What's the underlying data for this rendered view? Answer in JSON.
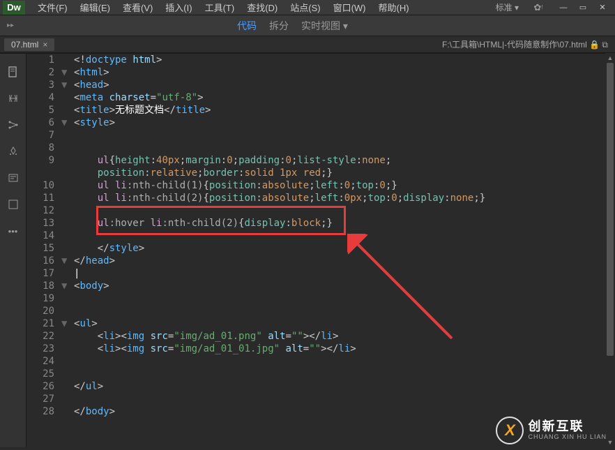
{
  "app": {
    "logo": "Dw"
  },
  "menu": {
    "file": "文件(F)",
    "edit": "编辑(E)",
    "view": "查看(V)",
    "insert": "插入(I)",
    "tools": "工具(T)",
    "find": "查找(D)",
    "site": "站点(S)",
    "window": "窗口(W)",
    "help": "帮助(H)"
  },
  "workspace": "标准 ▾",
  "viewTabs": {
    "code": "代码",
    "split": "拆分",
    "live": "实时视图 ▾"
  },
  "doc": {
    "tab": "07.html",
    "path": "F:\\工具箱\\HTML|-代码随意制作\\07.html"
  },
  "code": {
    "lines": [
      {
        "n": 1,
        "fold": "",
        "html": "<span class='t-punc'>&lt;!</span><span class='t-tag'>doctype</span> <span class='t-attr'>html</span><span class='t-punc'>&gt;</span>"
      },
      {
        "n": 2,
        "fold": "▼",
        "html": "<span class='t-punc'>&lt;</span><span class='t-tag'>html</span><span class='t-punc'>&gt;</span>"
      },
      {
        "n": 3,
        "fold": "▼",
        "html": "<span class='t-punc'>&lt;</span><span class='t-tag'>head</span><span class='t-punc'>&gt;</span>"
      },
      {
        "n": 4,
        "fold": "",
        "html": "<span class='t-punc'>&lt;</span><span class='t-tag'>meta</span> <span class='t-attr'>charset</span><span class='t-punc'>=</span><span class='t-str'>\"utf-8\"</span><span class='t-punc'>&gt;</span>"
      },
      {
        "n": 5,
        "fold": "",
        "html": "<span class='t-punc'>&lt;</span><span class='t-tag'>title</span><span class='t-punc'>&gt;</span><span class='t-txt'>无标题文档</span><span class='t-punc'>&lt;/</span><span class='t-tag'>title</span><span class='t-punc'>&gt;</span>"
      },
      {
        "n": 6,
        "fold": "▼",
        "html": "<span class='t-punc'>&lt;</span><span class='t-tag'>style</span><span class='t-punc'>&gt;</span>"
      },
      {
        "n": 7,
        "fold": "",
        "html": ""
      },
      {
        "n": 8,
        "fold": "",
        "html": ""
      },
      {
        "n": 9,
        "fold": "",
        "html": "    <span class='t-sel'>ul</span><span class='t-punc'>{</span><span class='t-prop'>height</span><span class='t-punc'>:</span><span class='t-ent'>40px</span><span class='t-punc'>;</span><span class='t-prop'>margin</span><span class='t-punc'>:</span><span class='t-ent'>0</span><span class='t-punc'>;</span><span class='t-prop'>padding</span><span class='t-punc'>:</span><span class='t-ent'>0</span><span class='t-punc'>;</span><span class='t-prop'>list-style</span><span class='t-punc'>:</span><span class='t-ent'>none</span><span class='t-punc'>;</span>"
      },
      {
        "n": "",
        "fold": "",
        "html": "    <span class='t-prop'>position</span><span class='t-punc'>:</span><span class='t-ent'>relative</span><span class='t-punc'>;</span><span class='t-prop'>border</span><span class='t-punc'>:</span><span class='t-ent'>solid 1px red</span><span class='t-punc'>;}</span>"
      },
      {
        "n": 10,
        "fold": "",
        "html": "    <span class='t-sel'>ul li</span><span class='t-pseudo'>:nth-child(1)</span><span class='t-punc'>{</span><span class='t-prop'>position</span><span class='t-punc'>:</span><span class='t-ent'>absolute</span><span class='t-punc'>;</span><span class='t-prop'>left</span><span class='t-punc'>:</span><span class='t-ent'>0</span><span class='t-punc'>;</span><span class='t-prop'>top</span><span class='t-punc'>:</span><span class='t-ent'>0</span><span class='t-punc'>;}</span>"
      },
      {
        "n": 11,
        "fold": "",
        "html": "    <span class='t-sel'>ul li</span><span class='t-pseudo'>:nth-child(2)</span><span class='t-punc'>{</span><span class='t-prop'>position</span><span class='t-punc'>:</span><span class='t-ent'>absolute</span><span class='t-punc'>;</span><span class='t-prop'>left</span><span class='t-punc'>:</span><span class='t-ent'>0px</span><span class='t-punc'>;</span><span class='t-prop'>top</span><span class='t-punc'>:</span><span class='t-ent'>0</span><span class='t-punc'>;</span><span class='t-prop'>display</span><span class='t-punc'>:</span><span class='t-ent'>none</span><span class='t-punc'>;}</span>"
      },
      {
        "n": 12,
        "fold": "",
        "html": ""
      },
      {
        "n": 13,
        "fold": "",
        "html": "    <span class='t-sel'>ul</span><span class='t-pseudo'>:hover</span> <span class='t-sel'>li</span><span class='t-pseudo'>:nth-child(2)</span><span class='t-punc'>{</span><span class='t-prop'>display</span><span class='t-punc'>:</span><span class='t-ent'>block</span><span class='t-punc'>;}</span>"
      },
      {
        "n": 14,
        "fold": "",
        "html": ""
      },
      {
        "n": 15,
        "fold": "",
        "html": "    <span class='t-punc'>&lt;/</span><span class='t-tag'>style</span><span class='t-punc'>&gt;</span>"
      },
      {
        "n": 16,
        "fold": "▼",
        "html": "<span class='t-punc'>&lt;/</span><span class='t-tag'>head</span><span class='t-punc'>&gt;</span>"
      },
      {
        "n": 17,
        "fold": "",
        "html": "<span class='t-txt'>|</span>"
      },
      {
        "n": 18,
        "fold": "▼",
        "html": "<span class='t-punc'>&lt;</span><span class='t-tag'>body</span><span class='t-punc'>&gt;</span>"
      },
      {
        "n": 19,
        "fold": "",
        "html": ""
      },
      {
        "n": 20,
        "fold": "",
        "html": ""
      },
      {
        "n": 21,
        "fold": "▼",
        "html": "<span class='t-punc'>&lt;</span><span class='t-tag'>ul</span><span class='t-punc'>&gt;</span>"
      },
      {
        "n": 22,
        "fold": "",
        "html": "    <span class='t-punc'>&lt;</span><span class='t-tag'>li</span><span class='t-punc'>&gt;&lt;</span><span class='t-tag'>img</span> <span class='t-attr'>src</span><span class='t-punc'>=</span><span class='t-str'>\"img/ad_01.png\"</span> <span class='t-attr'>alt</span><span class='t-punc'>=</span><span class='t-str'>\"\"</span><span class='t-punc'>&gt;&lt;/</span><span class='t-tag'>li</span><span class='t-punc'>&gt;</span>"
      },
      {
        "n": 23,
        "fold": "",
        "html": "    <span class='t-punc'>&lt;</span><span class='t-tag'>li</span><span class='t-punc'>&gt;&lt;</span><span class='t-tag'>img</span> <span class='t-attr'>src</span><span class='t-punc'>=</span><span class='t-str'>\"img/ad_01_01.jpg\"</span> <span class='t-attr'>alt</span><span class='t-punc'>=</span><span class='t-str'>\"\"</span><span class='t-punc'>&gt;&lt;/</span><span class='t-tag'>li</span><span class='t-punc'>&gt;</span>"
      },
      {
        "n": 24,
        "fold": "",
        "html": ""
      },
      {
        "n": 25,
        "fold": "",
        "html": ""
      },
      {
        "n": 26,
        "fold": "",
        "html": "<span class='t-punc'>&lt;/</span><span class='t-tag'>ul</span><span class='t-punc'>&gt;</span>"
      },
      {
        "n": 27,
        "fold": "",
        "html": ""
      },
      {
        "n": 28,
        "fold": "",
        "html": "<span class='t-punc'>&lt;/</span><span class='t-tag'>body</span><span class='t-punc'>&gt;</span>"
      }
    ]
  },
  "watermark": {
    "cn": "创新互联",
    "en": "CHUANG XIN HU LIAN"
  }
}
